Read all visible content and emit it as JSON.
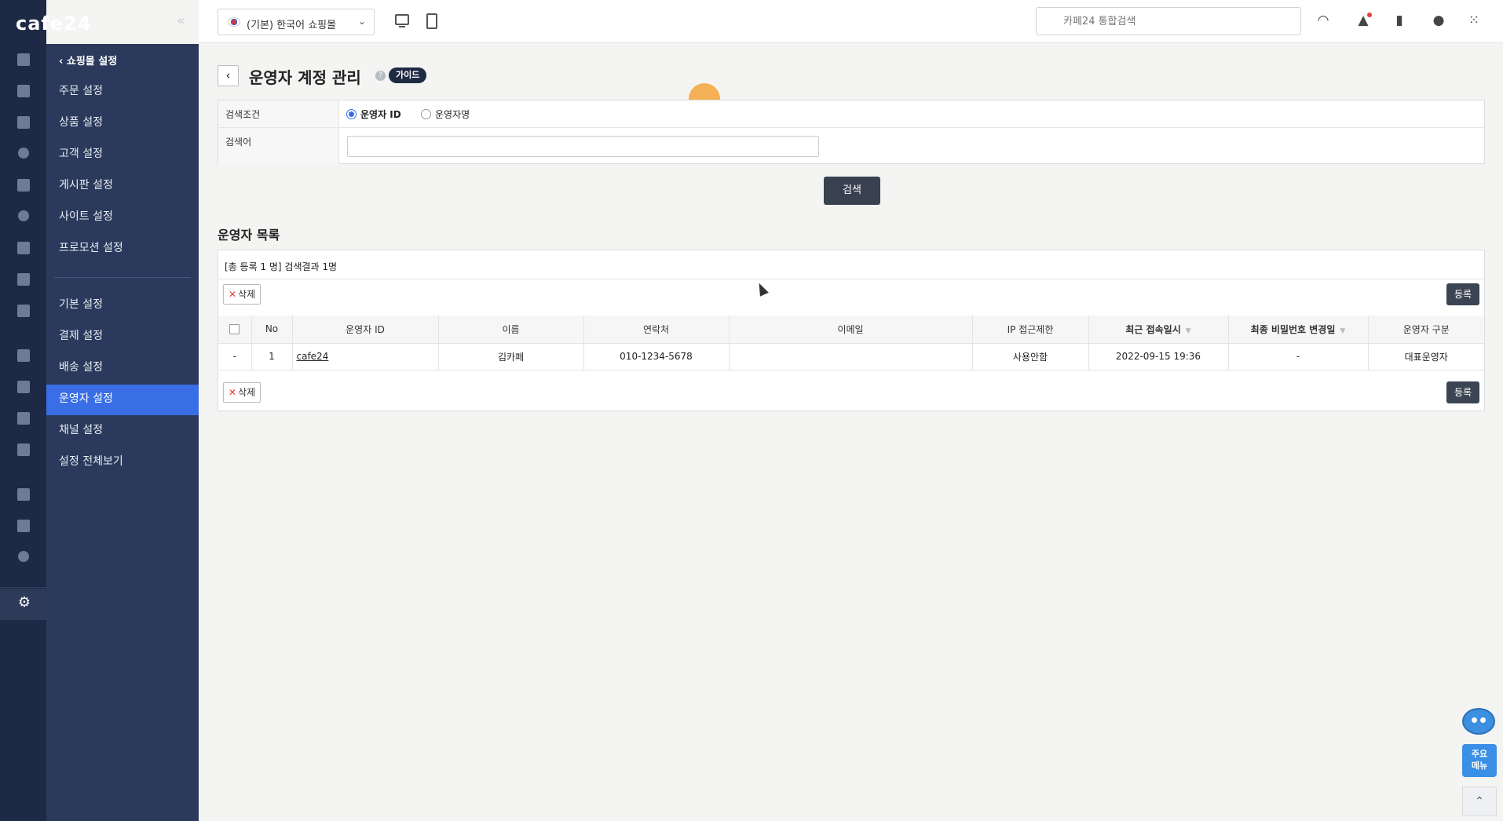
{
  "brand": {
    "logo": "cafe24",
    "collapse": "«"
  },
  "subnav": {
    "back": "쇼핑몰 설정",
    "items": [
      "주문 설정",
      "상품 설정",
      "고객 설정",
      "게시판 설정",
      "사이트 설정",
      "프로모션 설정",
      "기본 설정",
      "결제 설정",
      "배송 설정",
      "운영자 설정",
      "채널 설정",
      "설정 전체보기"
    ],
    "active": "운영자 설정"
  },
  "topbar": {
    "shop_select": "(기본) 한국어 쇼핑몰",
    "search_placeholder": "카페24 통합검색"
  },
  "page": {
    "title": "운영자 계정 관리",
    "help": "?",
    "guide": "가이드"
  },
  "search": {
    "condition_label": "검색조건",
    "option_id": "운영자 ID",
    "option_name": "운영자명",
    "keyword_label": "검색어",
    "button": "검색"
  },
  "list": {
    "title": "운영자 목록",
    "summary": "[총 등록 1 명] 검색결과 1명",
    "delete": "삭제",
    "register": "등록",
    "columns": [
      "No",
      "운영자 ID",
      "이름",
      "연락처",
      "이메일",
      "IP 접근제한",
      "최근 접속일시",
      "최종 비밀번호 변경일",
      "운영자 구분"
    ],
    "rows": [
      {
        "chk": "-",
        "no": "1",
        "id": "cafe24",
        "name": "김카페",
        "phone": "010-1234-5678",
        "email": "",
        "ip": "사용안함",
        "last_login": "2022-09-15 19:36",
        "pw_changed": "-",
        "type": "대표운영자"
      }
    ]
  },
  "floating": {
    "quick_menu_l1": "주요",
    "quick_menu_l2": "메뉴",
    "scroll_top": "⌃"
  }
}
